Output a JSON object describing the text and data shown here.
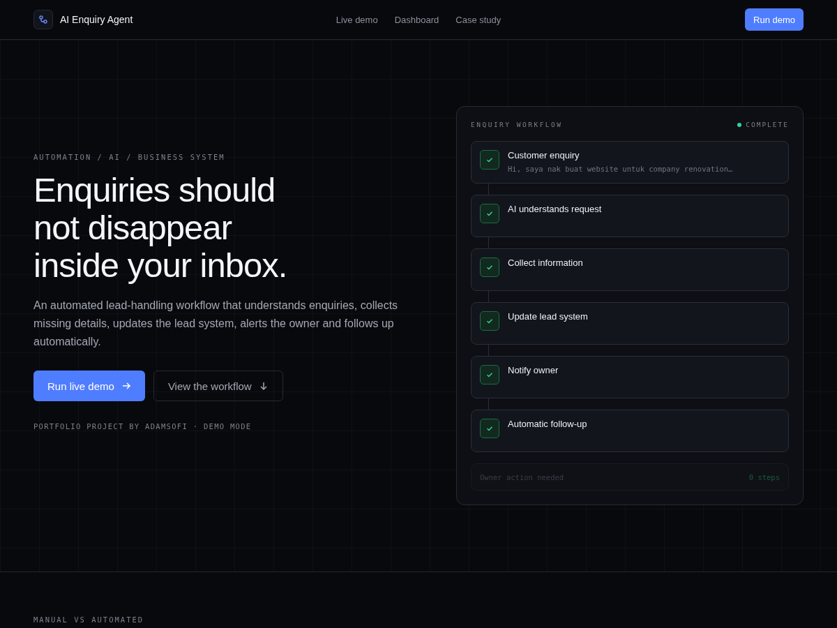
{
  "header": {
    "brand": "AI Enquiry Agent",
    "nav": [
      {
        "label": "Live demo"
      },
      {
        "label": "Dashboard"
      },
      {
        "label": "Case study"
      }
    ],
    "cta": "Run demo"
  },
  "hero": {
    "eyebrow": "AUTOMATION / AI / BUSINESS SYSTEM",
    "title": "Enquiries should not disappear inside your inbox.",
    "description": "An automated lead-handling workflow that understands enquiries, collects missing details, updates the lead system, alerts the owner and follows up automatically.",
    "primary_button": "Run live demo",
    "secondary_button": "View the workflow",
    "note": "PORTFOLIO PROJECT BY ADAMSOFI · DEMO MODE"
  },
  "workflow": {
    "title": "ENQUIRY WORKFLOW",
    "status": "COMPLETE",
    "steps": [
      {
        "label": "Customer enquiry",
        "detail": "Hi, saya nak buat website untuk company renovation…",
        "done": true
      },
      {
        "label": "AI understands request",
        "done": true
      },
      {
        "label": "Collect information",
        "done": true
      },
      {
        "label": "Update lead system",
        "done": true
      },
      {
        "label": "Notify owner",
        "done": true
      },
      {
        "label": "Automatic follow-up",
        "done": true
      }
    ],
    "footer_label": "Owner action needed",
    "footer_count": "0 steps"
  },
  "next_section": {
    "eyebrow": "MANUAL VS AUTOMATED"
  }
}
